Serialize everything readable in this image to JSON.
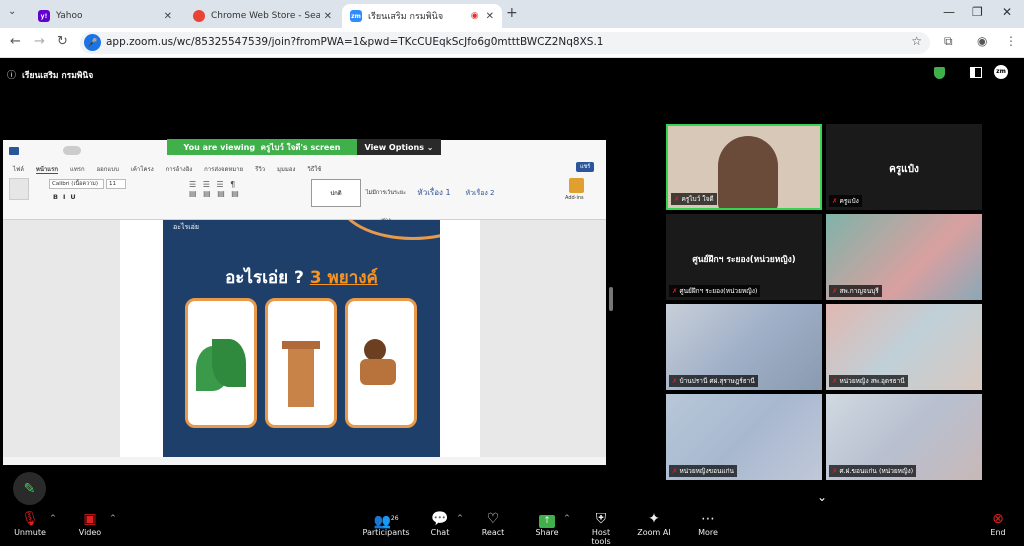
{
  "browser": {
    "tabs": [
      {
        "title": "Yahoo",
        "icon": "yahoo-icon",
        "color": "#6001d2"
      },
      {
        "title": "Chrome Web Store - Search Re",
        "icon": "chrome-icon",
        "color": "#ea4335"
      },
      {
        "title": "เรียนเสริม กรมพินิจ",
        "icon": "zoom-icon",
        "color": "#2d8cff",
        "active": true
      }
    ],
    "url": "app.zoom.us/wc/85325547539/join?fromPWA=1&pwd=TKcCUEqkScJfo6g0mtttBWCZ2Nq8XS.1"
  },
  "meeting": {
    "title": "เรียนเสริม กรมพินิจ",
    "badge": "zm",
    "viewing_prefix": "You are viewing",
    "viewing_user": "ครูไบว์ ใจดี's screen",
    "view_options": "View Options"
  },
  "shared_doc": {
    "ribbon_tabs": [
      "ไฟล์",
      "หน้าแรก",
      "แทรก",
      "ออกแบบ",
      "เค้าโครง",
      "การอ้างอิง",
      "การส่งจดหมาย",
      "รีวิว",
      "มุมมอง",
      "วิธีใช้"
    ],
    "font_name": "Calibri (เนื้อความ)",
    "font_size": "11",
    "styles": [
      "ปกติ",
      "ไม่มีการเว้นระยะห่าง",
      "หัวเรื่อง 1",
      "หัวเรื่อง 2"
    ],
    "addins_label": "Add-ins",
    "share_label": "แชร์",
    "slide_brand": "อะไรเอ่ย",
    "slide_title": "อะไรเอ่ย ?",
    "slide_title_highlight": "3 พยางค์"
  },
  "gallery": [
    {
      "name": "ครูไบว์ ใจดี",
      "type": "video",
      "active": true
    },
    {
      "name": "ครูแป๋ง",
      "type": "name",
      "center": "ครูแป๋ง"
    },
    {
      "name": "ศูนย์ฝึกฯ ระยอง(หน่วยหญิง)",
      "type": "name",
      "center": "ศูนย์ฝึกฯ ระยอง(หน่วยหญิง)"
    },
    {
      "name": "สพ.กาญจนบุรี",
      "type": "blur"
    },
    {
      "name": "บ้านปรานี ศฝ.สุราษฎร์ธานี",
      "type": "blur"
    },
    {
      "name": "หน่วยหญิง สพ.อุดรธานี",
      "type": "blur"
    },
    {
      "name": "หน่วยหญิงขอนแก่น",
      "type": "blur"
    },
    {
      "name": "ศ.ฝ.ขอนแก่น (หน่วยหญิง)",
      "type": "blur"
    }
  ],
  "controls": {
    "unmute": "Unmute",
    "video": "Video",
    "participants": "Participants",
    "participants_count": "26",
    "chat": "Chat",
    "react": "React",
    "share": "Share",
    "host_tools": "Host tools",
    "zoom_ai": "Zoom AI",
    "more": "More",
    "end": "End"
  },
  "colors": {
    "zoom_green": "#3fb04a",
    "end_red": "#e02020",
    "slide_bg": "#1f3f6b",
    "card_border": "#e89a4c",
    "active_speaker": "#39d353"
  }
}
